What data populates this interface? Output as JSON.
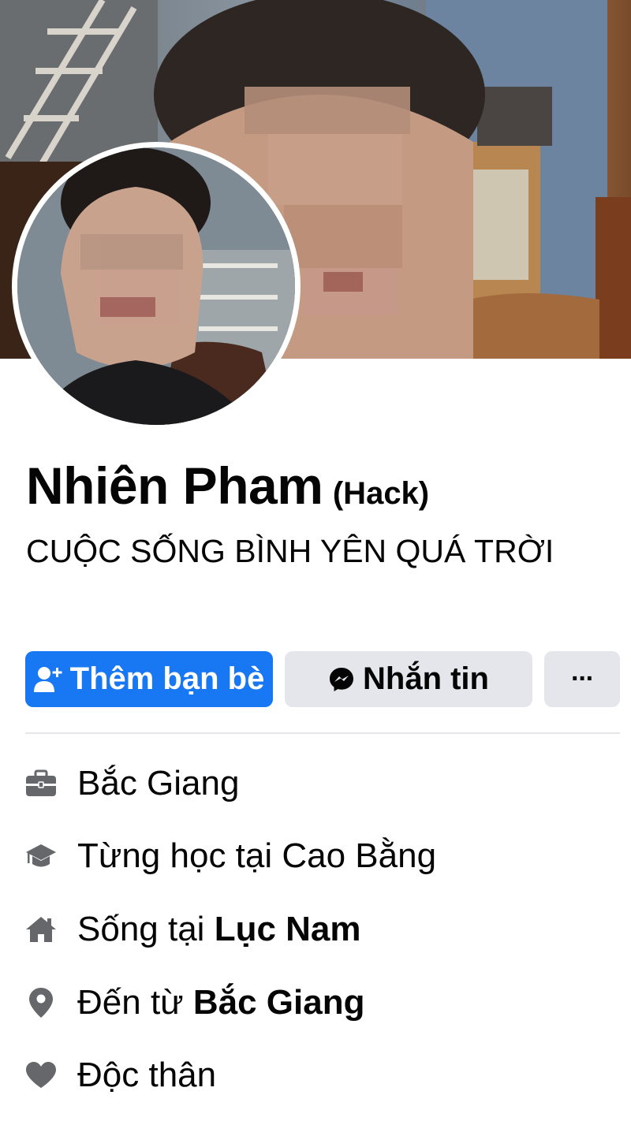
{
  "profile": {
    "name": "Nhiên Pham",
    "nickname": "(Hack)",
    "bio": "CUỘC SỐNG BÌNH YÊN QUÁ TRỜI"
  },
  "actions": {
    "add_friend": "Thêm bạn bè",
    "message": "Nhắn tin",
    "more": "···"
  },
  "details": [
    {
      "icon": "briefcase-icon",
      "text": "Bắc Giang"
    },
    {
      "icon": "graduation-cap-icon",
      "text": "Từng học tại Cao Bằng"
    },
    {
      "icon": "home-icon",
      "prefix": "Sống tại ",
      "bold": "Lục Nam"
    },
    {
      "icon": "location-pin-icon",
      "prefix": "Đến từ ",
      "bold": "Bắc Giang"
    },
    {
      "icon": "heart-icon",
      "text": "Độc thân"
    }
  ],
  "colors": {
    "primary_blue": "#1877f2",
    "secondary_button": "#e4e6eb",
    "icon_gray": "#65676b",
    "text": "#050505"
  }
}
